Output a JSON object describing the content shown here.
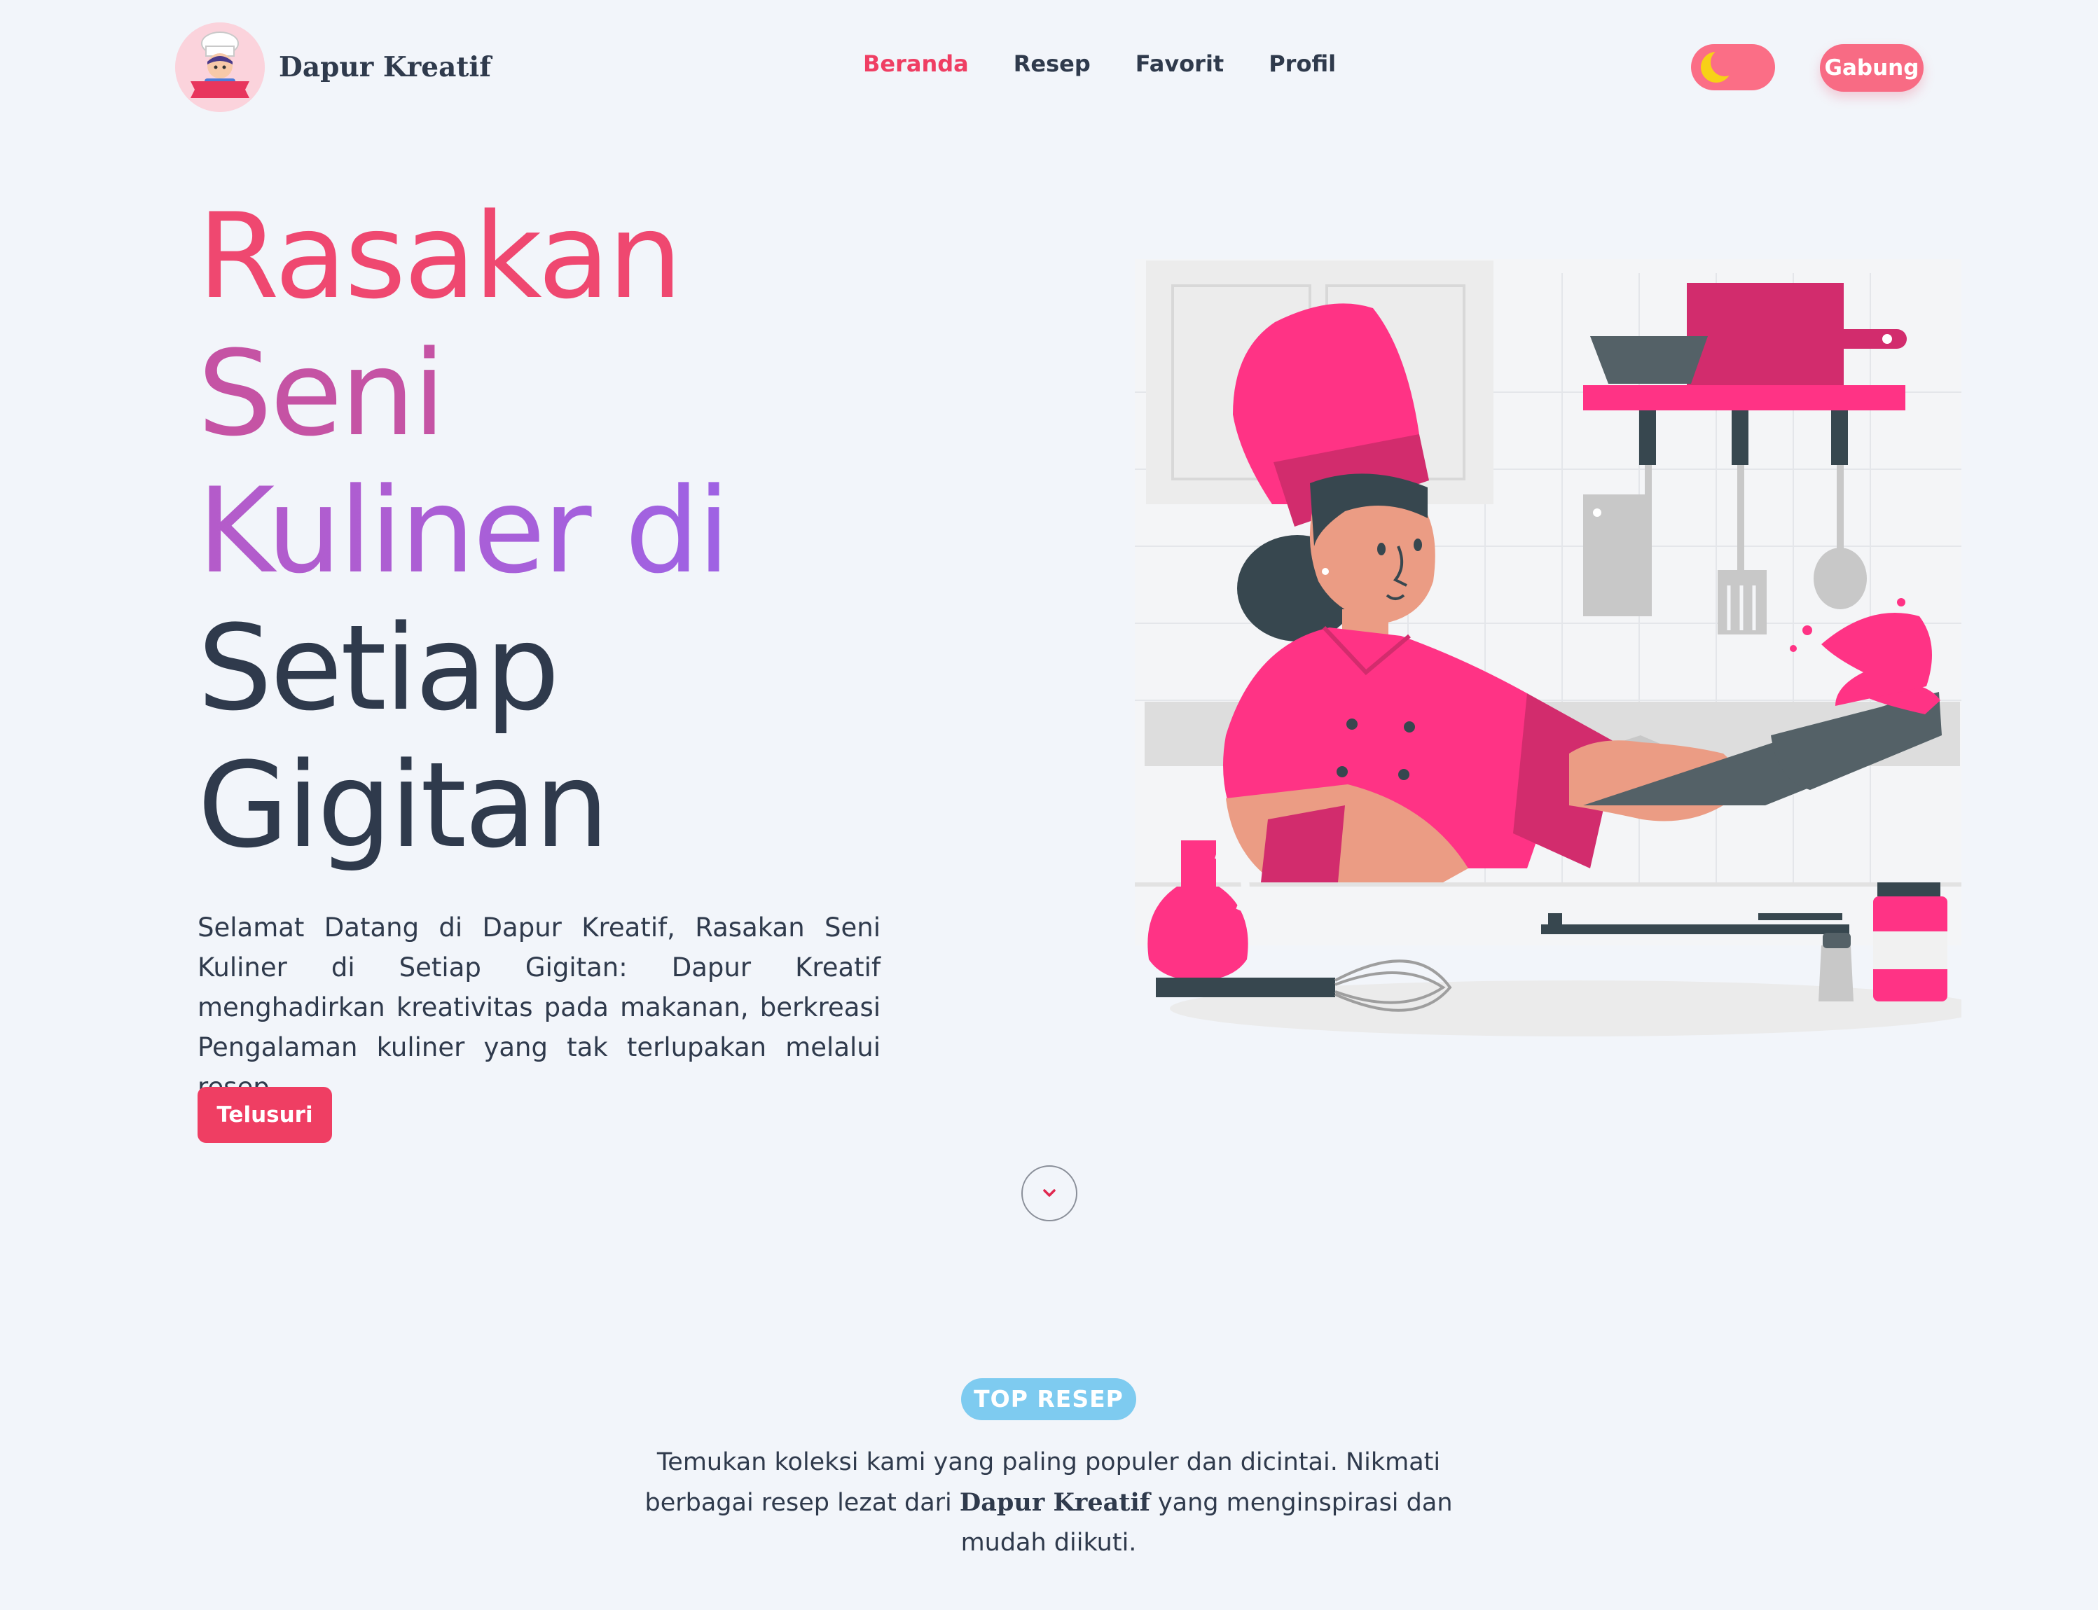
{
  "brand": {
    "name": "Dapur Kreatif",
    "logo_icon": "chef-mascot-icon"
  },
  "nav": {
    "items": [
      {
        "label": "Beranda",
        "active": true
      },
      {
        "label": "Resep",
        "active": false
      },
      {
        "label": "Favorit",
        "active": false
      },
      {
        "label": "Profil",
        "active": false
      }
    ],
    "theme_toggle_icon": "moon-icon",
    "join_label": "Gabung"
  },
  "hero": {
    "title_lines": [
      "Rasakan",
      "Seni",
      "Kuliner di",
      "Setiap",
      "Gigitan"
    ],
    "description": "Selamat Datang di Dapur Kreatif, Rasakan Seni Kuliner di Setiap Gigitan: Dapur Kreatif menghadirkan kreativitas pada makanan, berkreasi Pengalaman kuliner yang tak terlupakan melalui resep.",
    "cta_label": "Telusuri",
    "scroll_icon": "chevron-down-icon",
    "illustration_icon": "chef-cooking-illustration"
  },
  "top_recipes": {
    "badge": "TOP RESEP",
    "desc_before": "Temukan koleksi kami yang paling populer dan dicintai. Nikmati berbagai resep lezat dari ",
    "desc_brand": "Dapur Kreatif",
    "desc_after": " yang menginspirasi dan mudah diikuti."
  },
  "colors": {
    "accent": "#ef3e63",
    "badge": "#7ecbf0",
    "background": "#f2f5fa",
    "text": "#2f3a4c"
  }
}
